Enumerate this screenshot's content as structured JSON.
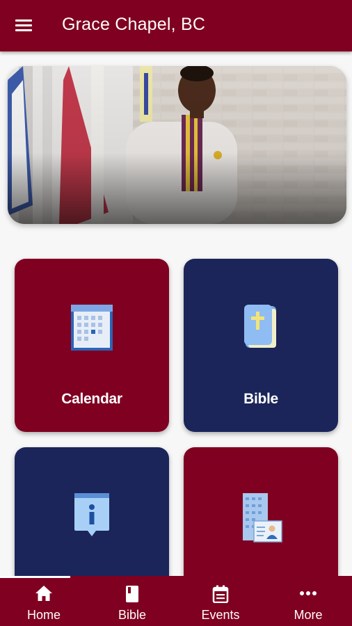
{
  "app_bar": {
    "title": "Grace Chapel, BC",
    "menu_icon": "menu-icon"
  },
  "hero": {
    "description_icon": "hero-photo"
  },
  "tiles": [
    {
      "label": "Calendar",
      "icon": "calendar-icon",
      "color": "#7f0020"
    },
    {
      "label": "Bible",
      "icon": "bible-icon",
      "color": "#1b255a"
    },
    {
      "label": "",
      "icon": "info-icon",
      "color": "#1b255a"
    },
    {
      "label": "",
      "icon": "directory-icon",
      "color": "#7f0020"
    }
  ],
  "bottom_nav": {
    "active": "Home",
    "items": [
      {
        "label": "Home",
        "icon": "home-icon"
      },
      {
        "label": "Bible",
        "icon": "book-icon"
      },
      {
        "label": "Events",
        "icon": "events-icon"
      },
      {
        "label": "More",
        "icon": "more-icon"
      }
    ]
  },
  "colors": {
    "primary": "#7f0020",
    "secondary": "#1b255a",
    "background": "#f7f7f7"
  }
}
